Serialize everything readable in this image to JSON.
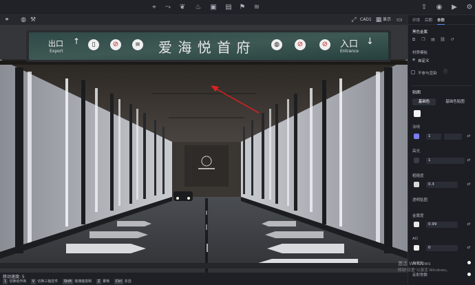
{
  "toolbar": {
    "icons": [
      "pin-icon",
      "path-icon",
      "leaf-icon",
      "fire-icon",
      "cube-icon",
      "image-icon",
      "flag-icon",
      "layers-icon"
    ],
    "right_icons": [
      "share-icon",
      "camera-icon",
      "video-icon",
      "settings-icon"
    ]
  },
  "viewport_bar": {
    "cad_label": "CAD1",
    "display_label": "显示"
  },
  "sign": {
    "exit_cn": "出口",
    "exit_en": "Export",
    "title": "爱 海 悦 首 府",
    "enter_cn": "入口",
    "enter_en": "Entrance"
  },
  "status": {
    "speed_label": "移动速度: 5",
    "hints": [
      {
        "key": "1",
        "text": "切换动作库"
      },
      {
        "key": "V",
        "text": "切换三轴控件"
      },
      {
        "key": "Shift",
        "text": "拖拽轴复制"
      },
      {
        "key": "Z",
        "text": "聚焦"
      },
      {
        "key": "Ctrl",
        "text": "多选"
      }
    ]
  },
  "panel": {
    "tabs": [
      "环境",
      "后期",
      "参数"
    ],
    "active_tab": 2,
    "material_title": "黑色金属",
    "material_library_label": "材质模板",
    "custom_label": "自定义",
    "render_label": "不参与渲染",
    "texture_section": "贴图",
    "base_color_tab": "基础色",
    "base_texture_tab": "基础色贴图",
    "normal_label": "法线",
    "normal_value": "1",
    "highlight_label": "高光",
    "highlight_value": "1",
    "roughness_label": "粗糙度",
    "roughness_value": "0.3",
    "transparency_label": "透明贴图",
    "metalness_label": "金属度",
    "metalness_value": "0.99",
    "ao_label": "AO",
    "ao_value": "0",
    "self_illumination_label": "自发光",
    "reflection_label": "反射常数",
    "watermark_title": "激活 Windows",
    "watermark_sub": "转到\"设置\"以激活 Windows。"
  },
  "colors": {
    "base_color": "#f2f2f2",
    "normal_color": "#7a7cf0",
    "roughness_color": "#d8d8d8",
    "metal_color": "#e8e8e8",
    "ao_color": "#f0f0f0",
    "accent": "#5b8cff"
  }
}
